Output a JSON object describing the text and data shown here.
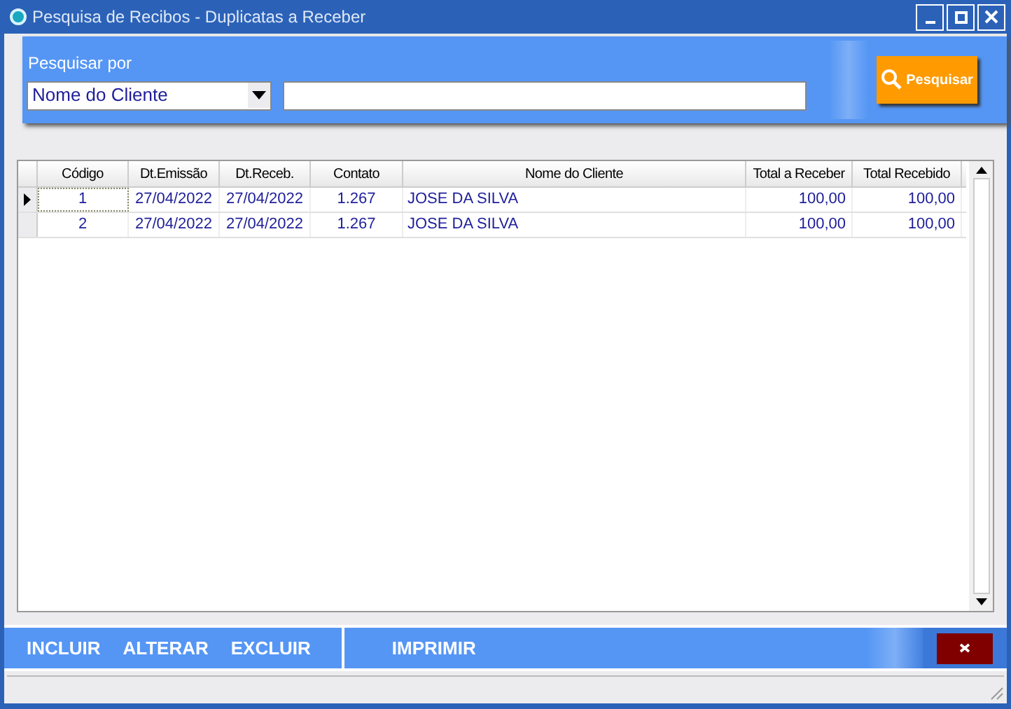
{
  "window": {
    "title": "Pesquisa de Recibos - Duplicatas a Receber"
  },
  "search": {
    "label": "Pesquisar por",
    "field": "Nome do Cliente",
    "button": "Pesquisar"
  },
  "table": {
    "columns": [
      "Código",
      "Dt.Emissão",
      "Dt.Receb.",
      "Contato",
      "Nome do Cliente",
      "Total a Receber",
      "Total Recebido"
    ],
    "rows": [
      {
        "selected": true,
        "cells": [
          "1",
          "27/04/2022",
          "27/04/2022",
          "1.267",
          "JOSE DA SILVA",
          "100,00",
          "100,00"
        ]
      },
      {
        "selected": false,
        "cells": [
          "2",
          "27/04/2022",
          "27/04/2022",
          "1.267",
          "JOSE DA SILVA",
          "100,00",
          "100,00"
        ]
      }
    ]
  },
  "actions": [
    "INCLUIR",
    "ALTERAR",
    "EXCLUIR",
    "IMPRIMIR"
  ]
}
